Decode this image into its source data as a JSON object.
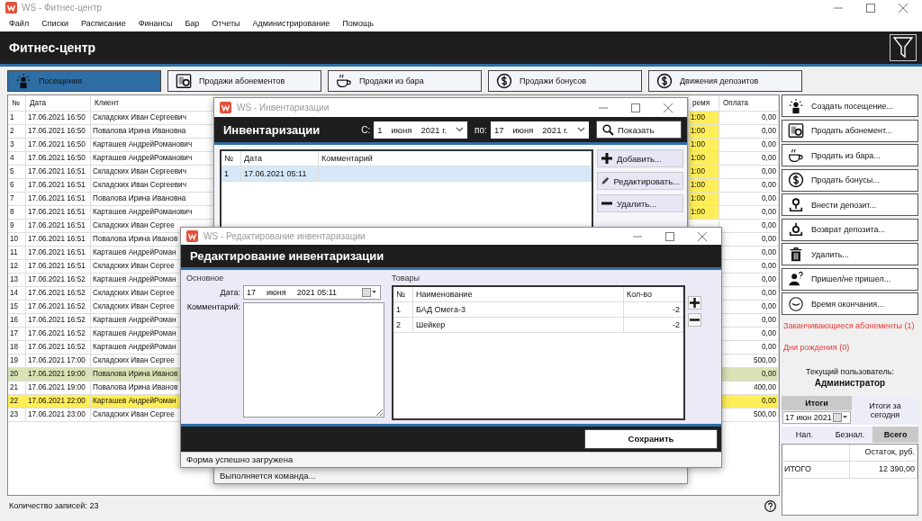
{
  "window": {
    "title": "WS - Фитнес-центр"
  },
  "menu": [
    "Файл",
    "Списки",
    "Расписание",
    "Финансы",
    "Бар",
    "Отчеты",
    "Администрирование",
    "Помощь"
  ],
  "header": {
    "title": "Фитнес-центр"
  },
  "tabs": [
    {
      "label": "Посещения",
      "kind": "visit",
      "selected": true
    },
    {
      "label": "Продажи абонементов",
      "kind": "subscription",
      "selected": false
    },
    {
      "label": "Продажи из бара",
      "kind": "cup",
      "selected": false
    },
    {
      "label": "Продажи бонусов",
      "kind": "dollar",
      "selected": false
    },
    {
      "label": "Движения депозитов",
      "kind": "dollar",
      "selected": false
    }
  ],
  "visits_table": {
    "columns": [
      "№",
      "Дата",
      "Клиент",
      "ремя",
      "Оплата"
    ],
    "rows": [
      {
        "no": "1",
        "date": "17.06.2021 16:50",
        "client": "Складских Иван Сергеевич",
        "time": {
          "text": "1:00",
          "color": "#ffee58"
        },
        "payment": "0,00"
      },
      {
        "no": "2",
        "date": "17.06.2021 16:50",
        "client": "Повалова Ирина Ивановна",
        "time": {
          "text": "1:00",
          "color": "#ffee58"
        },
        "payment": "0,00"
      },
      {
        "no": "3",
        "date": "17.06.2021 16:50",
        "client": "Карташев АндрейРоманович",
        "time": {
          "text": "1:00",
          "color": "#ffee58"
        },
        "payment": "0,00"
      },
      {
        "no": "4",
        "date": "17.06.2021 16:50",
        "client": "Карташев АндрейРоманович",
        "time": {
          "text": "1:00",
          "color": "#ffee58"
        },
        "payment": "0,00"
      },
      {
        "no": "5",
        "date": "17.06.2021 16:51",
        "client": "Складских Иван Сергеевич",
        "time": {
          "text": "1:00",
          "color": "#ffee58"
        },
        "payment": "0,00"
      },
      {
        "no": "6",
        "date": "17.06.2021 16:51",
        "client": "Складских Иван Сергеевич",
        "time": {
          "text": "1:00",
          "color": "#ffee58"
        },
        "payment": "0,00"
      },
      {
        "no": "7",
        "date": "17.06.2021 16:51",
        "client": "Повалова Ирина Ивановна",
        "time": {
          "text": "1:00",
          "color": "#ffee58"
        },
        "payment": "0,00"
      },
      {
        "no": "8",
        "date": "17.06.2021 16:51",
        "client": "Карташев АндрейРоманович",
        "time": {
          "text": "1:00",
          "color": "#ffee58"
        },
        "payment": "0,00"
      },
      {
        "no": "9",
        "date": "17.06.2021 16:51",
        "client": "Складских Иван Сергее",
        "payment": "0,00"
      },
      {
        "no": "10",
        "date": "17.06.2021 16:51",
        "client": "Повалова Ирина Иванов",
        "payment": "0,00"
      },
      {
        "no": "11",
        "date": "17.06.2021 16:51",
        "client": "Карташев АндрейРоман",
        "payment": "0,00"
      },
      {
        "no": "12",
        "date": "17.06.2021 16:51",
        "client": "Складских Иван Сергее",
        "payment": "0,00"
      },
      {
        "no": "13",
        "date": "17.06.2021 16:52",
        "client": "Карташев АндрейРоман",
        "payment": "0,00"
      },
      {
        "no": "14",
        "date": "17.06.2021 16:52",
        "client": "Складских Иван Сергее",
        "payment": "0,00"
      },
      {
        "no": "15",
        "date": "17.06.2021 16:52",
        "client": "Складских Иван Сергее",
        "payment": "0,00"
      },
      {
        "no": "16",
        "date": "17.06.2021 16:52",
        "client": "Карташев АндрейРоман",
        "payment": "0,00"
      },
      {
        "no": "17",
        "date": "17.06.2021 16:52",
        "client": "Карташев АндрейРоман",
        "payment": "0,00"
      },
      {
        "no": "18",
        "date": "17.06.2021 16:52",
        "client": "Карташев АндрейРоман",
        "payment": "0,00"
      },
      {
        "no": "19",
        "date": "17.06.2021 17:00",
        "client": "Складских Иван Сергее",
        "payment": "500,00"
      },
      {
        "no": "20",
        "date": "17.06.2021 19:00",
        "client": "Повалова Ирина Иванов",
        "payment": "0,00",
        "color": "#d8e2b4"
      },
      {
        "no": "21",
        "date": "17.06.2021 19:00",
        "client": "Повалова Ирина Иванов",
        "payment": "400,00"
      },
      {
        "no": "22",
        "date": "17.06.2021 22:00",
        "client": "Карташев АндрейРоман",
        "payment": "0,00",
        "color": "#ffee58"
      },
      {
        "no": "23",
        "date": "17.06.2021 23:00",
        "client": "Складских Иван Сергее",
        "payment": "500,00"
      }
    ]
  },
  "status_bar": "Количество записей: 23",
  "actions": [
    {
      "label": "Создать посещение...",
      "kind": "visit"
    },
    {
      "label": "Продать абонемент...",
      "kind": "subscription"
    },
    {
      "label": "Продать из бара...",
      "kind": "cup"
    },
    {
      "label": "Продать бонусы...",
      "kind": "dollar"
    },
    {
      "label": "Внести депозит...",
      "kind": "deposit-in"
    },
    {
      "label": "Возврат депозита...",
      "kind": "deposit-out"
    },
    {
      "label": "Удалить...",
      "kind": "trash"
    },
    {
      "label": "Пришел/не пришел...",
      "kind": "person-question"
    },
    {
      "label": "Время окончания...",
      "kind": "clock"
    }
  ],
  "alerts": [
    "Заканчивающиеся абонементы (1)",
    "Дни рождения (0)"
  ],
  "current_user": {
    "label": "Текущий пользователь:",
    "name": "Администратор"
  },
  "totals": {
    "tabs": [
      {
        "label": "Итоги",
        "selected": true
      },
      {
        "label": "Итоги за сегодня",
        "selected": false
      }
    ],
    "date": "17 июн 2021",
    "pay_tabs": [
      {
        "label": "Нал.",
        "selected": false
      },
      {
        "label": "Безнал.",
        "selected": false
      },
      {
        "label": "Всего",
        "selected": true
      }
    ],
    "column": "Остаток, руб.",
    "rows": [
      {
        "label": "ИТОГО",
        "value": "12 390,00"
      }
    ]
  },
  "inventory_window": {
    "title": "WS - Инвентаризации",
    "heading": "Инвентаризации",
    "from_label": "С:",
    "from": {
      "day": "1",
      "month": "июня",
      "year": "2021 г."
    },
    "to_label": "по:",
    "to": {
      "day": "17",
      "month": "июня",
      "year": "2021 г."
    },
    "show_button": "Показать",
    "columns": [
      "№",
      "Дата",
      "Комментарий"
    ],
    "rows": [
      {
        "no": "1",
        "date": "17.06.2021 05:11",
        "selected": true
      }
    ],
    "buttons": [
      {
        "label": "Добавить...",
        "kind": "plus"
      },
      {
        "label": "Редактировать...",
        "kind": "pencil"
      },
      {
        "label": "Удалить...",
        "kind": "minus"
      }
    ],
    "status": "Выполняется команда..."
  },
  "edit_window": {
    "title": "WS - Редактирование инвентаризации",
    "heading": "Редактирование инвентаризации",
    "group_main": "Основное",
    "date_label": "Дата:",
    "date": {
      "day": "17",
      "month": "июня",
      "time": "2021 05:11"
    },
    "comment_label": "Комментарий:",
    "group_goods": "Товары",
    "columns": [
      "№",
      "Наименование",
      "Кол-во"
    ],
    "rows": [
      {
        "no": "1",
        "name": "БАД Омега-3",
        "qty": "-2"
      },
      {
        "no": "2",
        "name": "Шейкер",
        "qty": "-2"
      }
    ],
    "save_button": "Сохранить",
    "status": "Форма успешно загружена"
  }
}
